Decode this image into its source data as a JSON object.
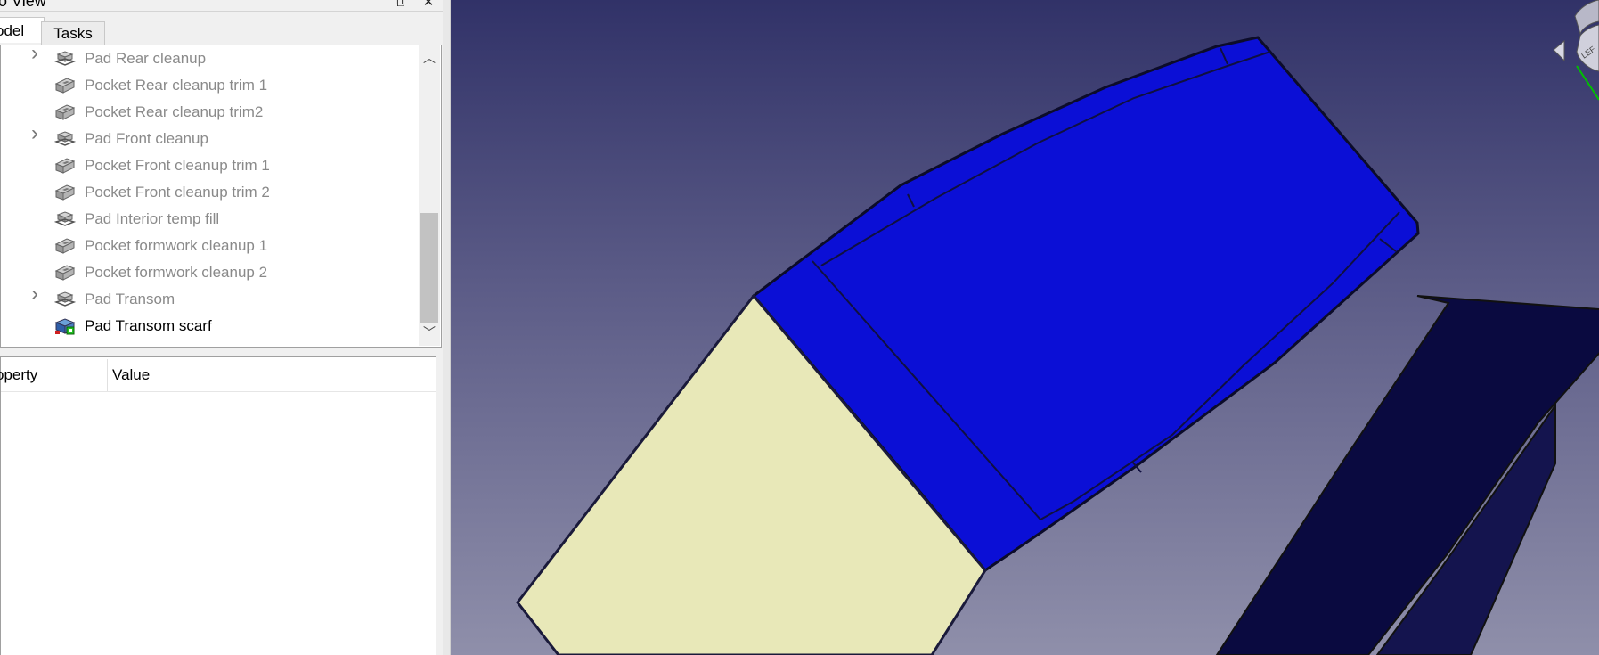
{
  "panel": {
    "title": "nbo View",
    "tabs": {
      "model": "odel",
      "tasks": "Tasks"
    }
  },
  "tree": {
    "items": [
      {
        "label": "Pad Rear cleanup",
        "expandable": true,
        "icon": "pad-feature-icon",
        "active": false
      },
      {
        "label": "Pocket Rear cleanup trim 1",
        "expandable": false,
        "icon": "pocket-feature-icon",
        "active": false
      },
      {
        "label": "Pocket Rear cleanup trim2",
        "expandable": false,
        "icon": "pocket-feature-icon",
        "active": false
      },
      {
        "label": "Pad Front cleanup",
        "expandable": true,
        "icon": "pad-feature-icon",
        "active": false
      },
      {
        "label": "Pocket Front cleanup trim 1",
        "expandable": false,
        "icon": "pocket-feature-icon",
        "active": false
      },
      {
        "label": "Pocket Front cleanup trim 2",
        "expandable": false,
        "icon": "pocket-feature-icon",
        "active": false
      },
      {
        "label": "Pad Interior temp fill",
        "expandable": false,
        "icon": "pad-feature-icon",
        "active": false
      },
      {
        "label": "Pocket formwork cleanup 1",
        "expandable": false,
        "icon": "pocket-feature-icon",
        "active": false
      },
      {
        "label": "Pocket formwork cleanup 2",
        "expandable": false,
        "icon": "pocket-feature-icon",
        "active": false
      },
      {
        "label": "Pad Transom",
        "expandable": true,
        "icon": "pad-feature-icon",
        "active": false
      },
      {
        "label": "Pad Transom scarf",
        "expandable": false,
        "icon": "pad-active-feature-icon",
        "active": true
      }
    ]
  },
  "properties": {
    "col_property": "operty",
    "col_value": "Value"
  },
  "viewport": {
    "navcube_face": "LEF",
    "colors": {
      "bg_top": "#313268",
      "bg_bottom": "#8f8faa",
      "face_blue": "#0b0fd6",
      "face_cream": "#e8e8b8",
      "face_dark": "#0a0a40"
    }
  }
}
